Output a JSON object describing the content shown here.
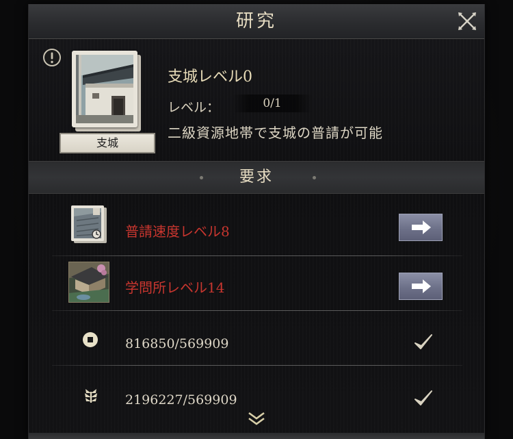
{
  "window": {
    "title": "研究"
  },
  "research": {
    "card_label": "支城",
    "name": "支城レベル0",
    "level_label": "レベル：",
    "level_value": "0/1",
    "description": "二級資源地帯で支城の普請が可能"
  },
  "requirements": {
    "title": "要求",
    "items": [
      {
        "label": "普請速度レベル8",
        "status": "unmet",
        "thumb_icon": "castle-wall-research-icon",
        "button_icon": "arrow-right-icon"
      },
      {
        "label": "学問所レベル14",
        "status": "unmet",
        "thumb_icon": "school-building-icon",
        "button_icon": "arrow-right-icon"
      }
    ],
    "resources": [
      {
        "icon": "coin-icon",
        "amount": "816850/569909",
        "status": "met"
      },
      {
        "icon": "rice-grain-icon",
        "amount": "2196227/569909",
        "status": "met"
      }
    ]
  },
  "colors": {
    "unmet_text": "#c8362f",
    "title_text": "#e6dcc2",
    "button": "#6d7189"
  }
}
